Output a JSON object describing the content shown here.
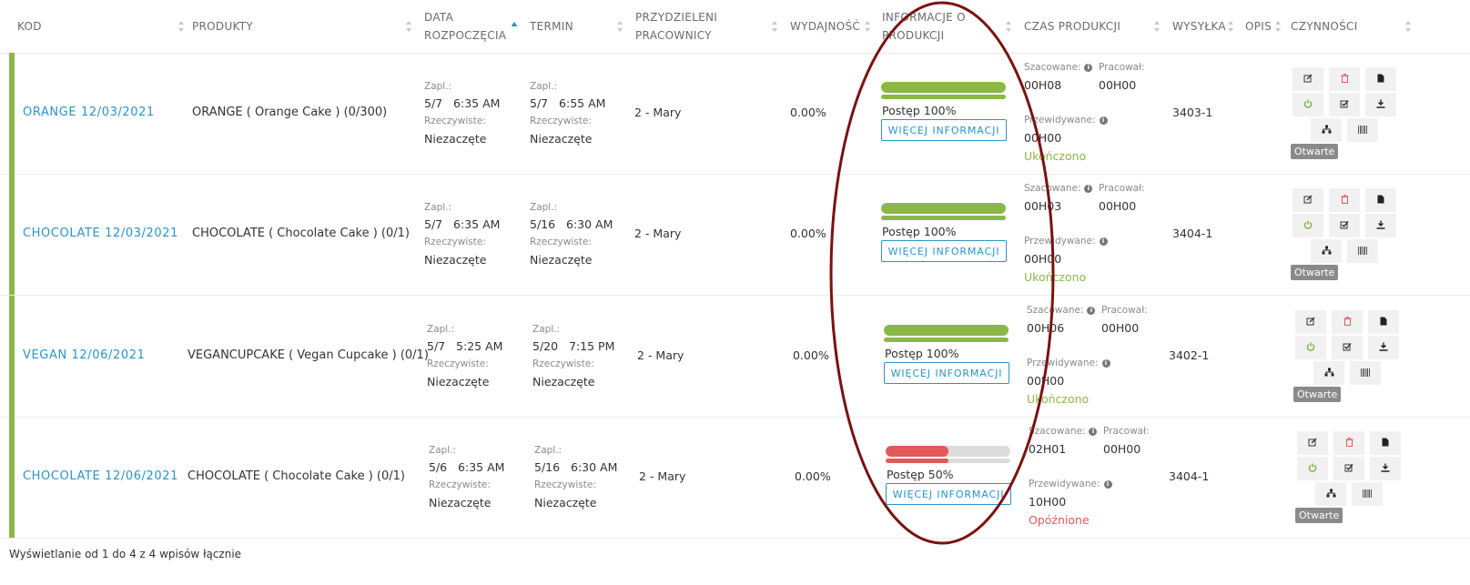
{
  "headers": {
    "kod": "KOD",
    "produkty": "PRODUKTY",
    "data_rozpoczecia": [
      "DATA",
      "ROZPOCZĘCIA"
    ],
    "termin": "TERMIN",
    "przydzieleni": [
      "PRZYDZIELENI",
      "PRACOWNICY"
    ],
    "wydajnosc": "WYDAJNOŚĆ",
    "informacje": [
      "INFORMACJE O",
      "PRODUKCJI"
    ],
    "czas_produkcji": "CZAS PRODUKCJI",
    "wysylka": "WYSYŁKA",
    "opis": "OPIS",
    "czynnosci": "CZYNNOŚCI"
  },
  "labels": {
    "zapl": "Zapl.:",
    "rzeczywiste": "Rzeczywiste:",
    "szacowane": "Szacowane:",
    "pracowal": "Pracował:",
    "przewidywane": "Przewidywane:",
    "wiecej": "WIĘCEJ INFORMACJI",
    "otwarte": "Otwarte"
  },
  "rows": [
    {
      "code": "ORANGE 12/03/2021",
      "product": "ORANGE ( Orange Cake ) (0/300)",
      "start_planned": "5/7   6:35 AM",
      "start_actual": "Niezaczęte",
      "term_planned": "5/7   6:55 AM",
      "term_actual": "Niezaczęte",
      "workers": "2 - Mary",
      "efficiency": "0.00%",
      "progress_text": "Postęp 100%",
      "progress": 1.0,
      "progress_color": "#8bb74a",
      "estimated": "00H08",
      "worked": "00H00",
      "predicted": "00H00",
      "status": "Ukończono",
      "status_color": "#8bb74a",
      "shipment": "3403-1"
    },
    {
      "code": "CHOCOLATE 12/03/2021",
      "product": "CHOCOLATE ( Chocolate Cake ) (0/1)",
      "start_planned": "5/7   6:35 AM",
      "start_actual": "Niezaczęte",
      "term_planned": "5/16   6:30 AM",
      "term_actual": "Niezaczęte",
      "workers": "2 - Mary",
      "efficiency": "0.00%",
      "progress_text": "Postęp 100%",
      "progress": 1.0,
      "progress_color": "#8bb74a",
      "estimated": "00H03",
      "worked": "00H00",
      "predicted": "00H00",
      "status": "Ukończono",
      "status_color": "#8bb74a",
      "shipment": "3404-1"
    },
    {
      "code": "VEGAN 12/06/2021",
      "product": "VEGANCUPCAKE ( Vegan Cupcake ) (0/1)",
      "start_planned": "5/7   5:25 AM",
      "start_actual": "Niezaczęte",
      "term_planned": "5/20   7:15 PM",
      "term_actual": "Niezaczęte",
      "workers": "2 - Mary",
      "efficiency": "0.00%",
      "progress_text": "Postęp 100%",
      "progress": 1.0,
      "progress_color": "#8bb74a",
      "estimated": "00H06",
      "worked": "00H00",
      "predicted": "00H00",
      "status": "Ukończono",
      "status_color": "#8bb74a",
      "shipment": "3402-1"
    },
    {
      "code": "CHOCOLATE 12/06/2021",
      "product": "CHOCOLATE ( Chocolate Cake ) (0/1)",
      "start_planned": "5/6   6:35 AM",
      "start_actual": "Niezaczęte",
      "term_planned": "5/16   6:30 AM",
      "term_actual": "Niezaczęte",
      "workers": "2 - Mary",
      "efficiency": "0.00%",
      "progress_text": "Postęp 50%",
      "progress": 0.5,
      "progress_color": "#e05a5a",
      "estimated": "02H01",
      "worked": "00H00",
      "predicted": "10H00",
      "status": "Opóźnione",
      "status_color": "#e05a5a",
      "shipment": "3404-1"
    }
  ],
  "footer": "Wyświetlanie od 1 do 4 z 4 wpisów łącznie",
  "colors": {
    "accent_link": "#2a93c9",
    "row_bar": "#8bb74a",
    "highlight_ring": "#7a1212"
  }
}
